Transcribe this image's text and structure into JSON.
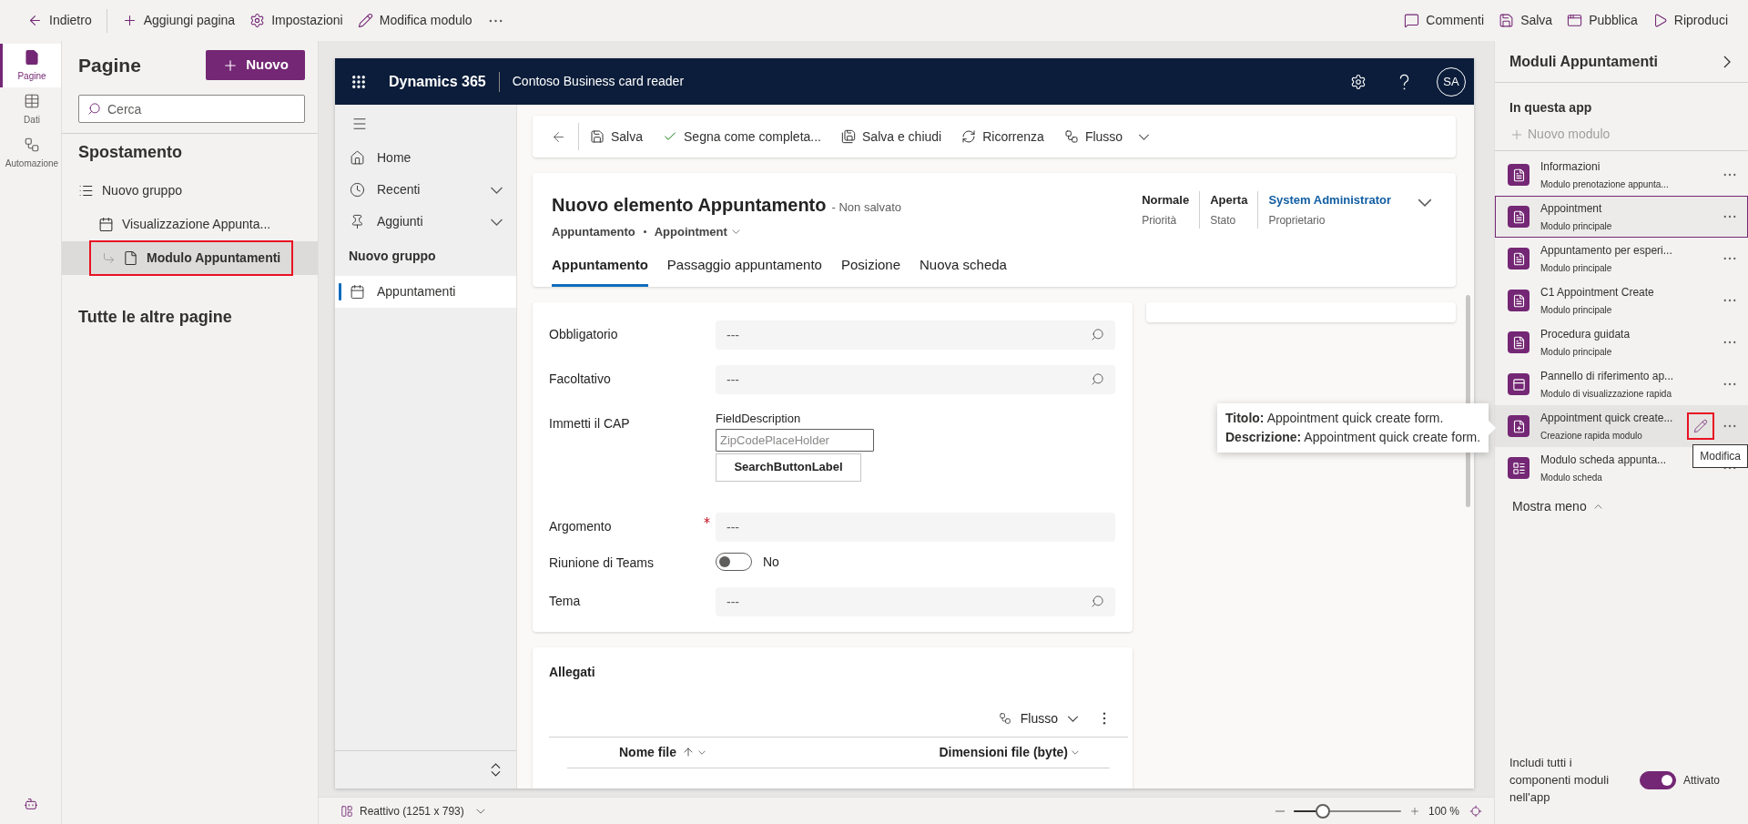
{
  "toolbar": {
    "left": [
      {
        "kind": "back",
        "label": "Indietro"
      },
      {
        "kind": "add",
        "label": "Aggiungi pagina"
      },
      {
        "kind": "settings",
        "label": "Impostazioni"
      },
      {
        "kind": "edit",
        "label": "Modifica modulo"
      }
    ],
    "right": [
      {
        "kind": "comments",
        "label": "Commenti"
      },
      {
        "kind": "save",
        "label": "Salva"
      },
      {
        "kind": "publish",
        "label": "Pubblica"
      },
      {
        "kind": "play",
        "label": "Riproduci"
      }
    ]
  },
  "rail": [
    {
      "kind": "pages",
      "label": "Pagine",
      "selected": true
    },
    {
      "kind": "data",
      "label": "Dati",
      "selected": false
    },
    {
      "kind": "automation",
      "label": "Automazione",
      "selected": false
    }
  ],
  "pages_panel": {
    "title": "Pagine",
    "new_button": "Nuovo",
    "search": {
      "placeholder": "Cerca"
    },
    "navigation_heading": "Spostamento",
    "tree": [
      {
        "kind": "group",
        "label": "Nuovo gruppo",
        "selected": false,
        "highlighted": false,
        "children": [
          {
            "kind": "view",
            "label": "Visualizzazione Appunta...",
            "selected": false,
            "highlighted": false,
            "children": [
              {
                "kind": "form",
                "label": "Modulo Appuntamenti",
                "selected": true,
                "highlighted": true
              }
            ]
          }
        ]
      }
    ],
    "other_pages_heading": "Tutte le altre pagine"
  },
  "app": {
    "brand": "Dynamics 365",
    "app_name": "Contoso Business card reader",
    "avatar": "SA",
    "nav": {
      "items": [
        {
          "kind": "home",
          "label": "Home",
          "expandable": false
        },
        {
          "kind": "recent",
          "label": "Recenti",
          "expandable": true
        },
        {
          "kind": "pinned",
          "label": "Aggiunti",
          "expandable": true
        }
      ],
      "group_heading": "Nuovo gruppo",
      "group_items": [
        {
          "kind": "calendar",
          "label": "Appuntamenti",
          "selected": true
        }
      ]
    },
    "command_bar": [
      {
        "kind": "save",
        "label": "Salva",
        "has_menu": false
      },
      {
        "kind": "complete",
        "label": "Segna come completa...",
        "has_menu": false
      },
      {
        "kind": "save_close",
        "label": "Salva e chiudi",
        "has_menu": false
      },
      {
        "kind": "recurrence",
        "label": "Ricorrenza",
        "has_menu": false
      },
      {
        "kind": "flow",
        "label": "Flusso",
        "has_menu": true
      }
    ],
    "record": {
      "title": "Nuovo elemento Appuntamento",
      "status": "- Non salvato",
      "entity": "Appuntamento",
      "form_selector": "Appointment",
      "header_fields": [
        {
          "value": "Normale",
          "label": "Priorità",
          "link": false
        },
        {
          "value": "Aperta",
          "label": "Stato",
          "link": false
        },
        {
          "value": "System Administrator",
          "label": "Proprietario",
          "link": true
        }
      ],
      "tabs": [
        {
          "label": "Appuntamento",
          "selected": true
        },
        {
          "label": "Passaggio appuntamento",
          "selected": false
        },
        {
          "label": "Posizione",
          "selected": false
        },
        {
          "label": "Nuova scheda",
          "selected": false
        }
      ]
    },
    "form_fields": [
      {
        "kind": "lookup",
        "label": "Obbligatorio",
        "placeholder": "---",
        "required": false
      },
      {
        "kind": "lookup",
        "label": "Facoltativo",
        "placeholder": "---",
        "required": false
      },
      {
        "kind": "zip",
        "label": "Immetti il CAP",
        "description": "FieldDescription",
        "placeholder": "ZipCodePlaceHolder",
        "button": "SearchButtonLabel"
      },
      {
        "kind": "text",
        "label": "Argomento",
        "placeholder": "---",
        "required": true
      },
      {
        "kind": "toggle",
        "label": "Riunione di Teams",
        "on": false,
        "value": "No"
      },
      {
        "kind": "lookup",
        "label": "Tema",
        "placeholder": "---",
        "required": false
      }
    ],
    "attachments": {
      "title": "Allegati",
      "flow_button": "Flusso",
      "columns": [
        {
          "label": "Nome file",
          "sorted": true
        },
        {
          "label": "Dimensioni file (byte)",
          "sorted": false
        }
      ]
    }
  },
  "status_bar": {
    "viewport": "Reattivo (1251 x 793)",
    "zoom": {
      "level": 0.27,
      "reading": "100 %"
    }
  },
  "tooltip": {
    "lines": [
      "**Titolo:** Appointment quick create form.",
      "**Descrizione:** Appointment quick create form."
    ]
  },
  "forms_panel": {
    "title": "Moduli Appuntamenti",
    "section": "In questa app",
    "new_form": {
      "label": "Nuovo modulo",
      "disabled": true
    },
    "forms": [
      {
        "kind": "main",
        "name": "Informazioni",
        "type": "Modulo prenotazione appunta...",
        "selected": false,
        "hovered": false
      },
      {
        "kind": "main",
        "name": "Appointment",
        "type": "Modulo principale",
        "selected": true,
        "hovered": false
      },
      {
        "kind": "main",
        "name": "Appuntamento per esperi...",
        "type": "Modulo principale",
        "selected": false,
        "hovered": false
      },
      {
        "kind": "main",
        "name": "C1 Appointment Create",
        "type": "Modulo principale",
        "selected": false,
        "hovered": false
      },
      {
        "kind": "main",
        "name": "Procedura guidata",
        "type": "Modulo principale",
        "selected": false,
        "hovered": false
      },
      {
        "kind": "quick_view",
        "name": "Pannello di riferimento ap...",
        "type": "Modulo di visualizzazione rapida",
        "selected": false,
        "hovered": false
      },
      {
        "kind": "quick_create",
        "name": "Appointment quick create...",
        "type": "Creazione rapida modulo",
        "selected": false,
        "hovered": true,
        "edit": {
          "tooltip": "Modifica",
          "highlighted": true
        }
      },
      {
        "kind": "card",
        "name": "Modulo scheda appunta...",
        "type": "Modulo scheda",
        "selected": false,
        "hovered": false
      }
    ],
    "show_less": "Mostra meno",
    "include_all": {
      "label": "Includi tutti i componenti moduli nell'app",
      "on": true,
      "value": "Attivato"
    }
  }
}
